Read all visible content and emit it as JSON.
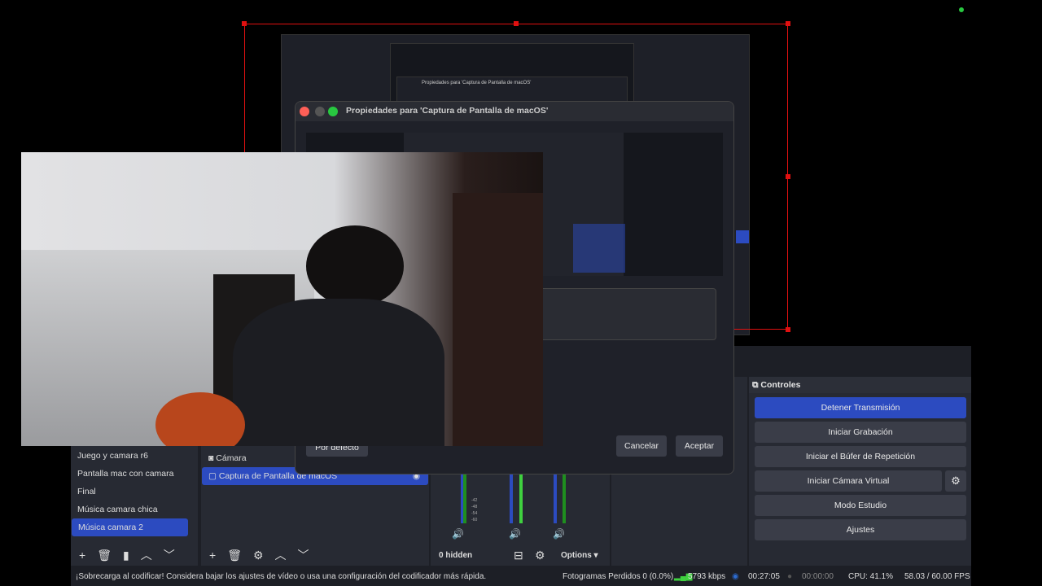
{
  "scenes": {
    "items": [
      "Juego y camara r6",
      "Pantalla mac con camara",
      "Final",
      "Música camara chica",
      "Música camara 2"
    ],
    "selected": "Música camara 2"
  },
  "sources": {
    "items": [
      "Cámara",
      "Captura de Pantalla de macOS"
    ],
    "selected": "Captura de Pantalla de macOS"
  },
  "mixer": {
    "hidden_label": "0 hidden",
    "options_label": "Options",
    "ticks": [
      "-42",
      "-48",
      "-54",
      "-60"
    ]
  },
  "controls": {
    "title": "Controles",
    "buttons": [
      "Detener Transmisión",
      "Iniciar Grabación",
      "Iniciar el Búfer de Repetición",
      "Iniciar Cámara Virtual",
      "Modo Estudio",
      "Ajustes"
    ],
    "active_color": "#2c4bc0"
  },
  "dialog": {
    "title": "Propiedades para 'Captura de Pantalla de macOS'",
    "defaults_label": "Por defecto",
    "cancel_label": "Cancelar",
    "accept_label": "Aceptar"
  },
  "nested": {
    "title": "Propiedades para 'Captura de Pantalla de macOS'"
  },
  "status": {
    "message": "¡Sobrecarga al codificar! Considera bajar los ajustes de vídeo o usa una configuración del codificador más rápida.",
    "dropped": "Fotogramas Perdidos 0 (0.0%)",
    "bitrate": "5793 kbps",
    "stream_time": "00:27:05",
    "record_time": "00:00:00",
    "cpu": "CPU: 41.1%",
    "fps": "58.03 / 60.00 FPS"
  }
}
